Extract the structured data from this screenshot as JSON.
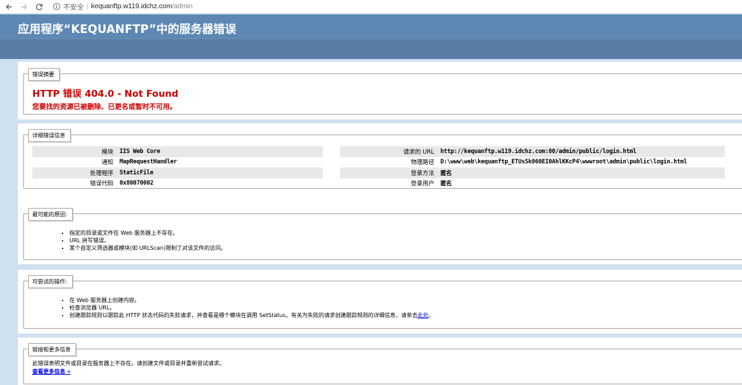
{
  "browser": {
    "insecure_label": "不安全",
    "url_host": "kequanftp.w119.idchz.com",
    "url_path": "/admin"
  },
  "header": {
    "title": "应用程序“KEQUANFTP”中的服务器错误"
  },
  "summary": {
    "legend": "错误摘要",
    "title": "HTTP 错误 404.0 - Not Found",
    "message": "您要找的资源已被删除、已更名或暂时不可用。"
  },
  "details": {
    "legend": "详细错误信息",
    "left": [
      {
        "label": "模块",
        "value": "IIS Web Core"
      },
      {
        "label": "通知",
        "value": "MapRequestHandler"
      },
      {
        "label": "处理程序",
        "value": "StaticFile"
      },
      {
        "label": "错误代码",
        "value": "0x80070002"
      }
    ],
    "right": [
      {
        "label": "请求的 URL",
        "value": "http://kequanftp.w119.idchz.com:80/admin/public/login.html"
      },
      {
        "label": "物理路径",
        "value": "D:\\www\\web\\kequanftp_ETUsSk060EI0AhlKKcP4\\wwwroot\\admin\\public\\login.html"
      },
      {
        "label": "登录方法",
        "value": "匿名"
      },
      {
        "label": "登录用户",
        "value": "匿名"
      }
    ]
  },
  "causes": {
    "legend": "最可能的原因:",
    "items": [
      "指定的目录或文件在 Web 服务器上不存在。",
      "URL 拼写错误。",
      "某个自定义筛选器或模块(如 URLScan)限制了对该文件的访问。"
    ]
  },
  "actions": {
    "legend": "可尝试的操作:",
    "items": [
      "在 Web 服务器上创建内容。",
      "检查浏览器 URL。"
    ],
    "last_item_text": "创建跟踪规则以跟踪此 HTTP 状态代码的失败请求，并查看是哪个模块在调用 SetStatus。有关为失败的请求创建跟踪规则的详细信息，请单击",
    "last_item_link": "此处",
    "last_item_end": "。"
  },
  "links": {
    "legend": "链接和更多信息",
    "text": "此错误表明文件或目录在服务器上不存在。请创建文件或目录并重新尝试请求。",
    "more_link": "查看更多信息 »"
  }
}
